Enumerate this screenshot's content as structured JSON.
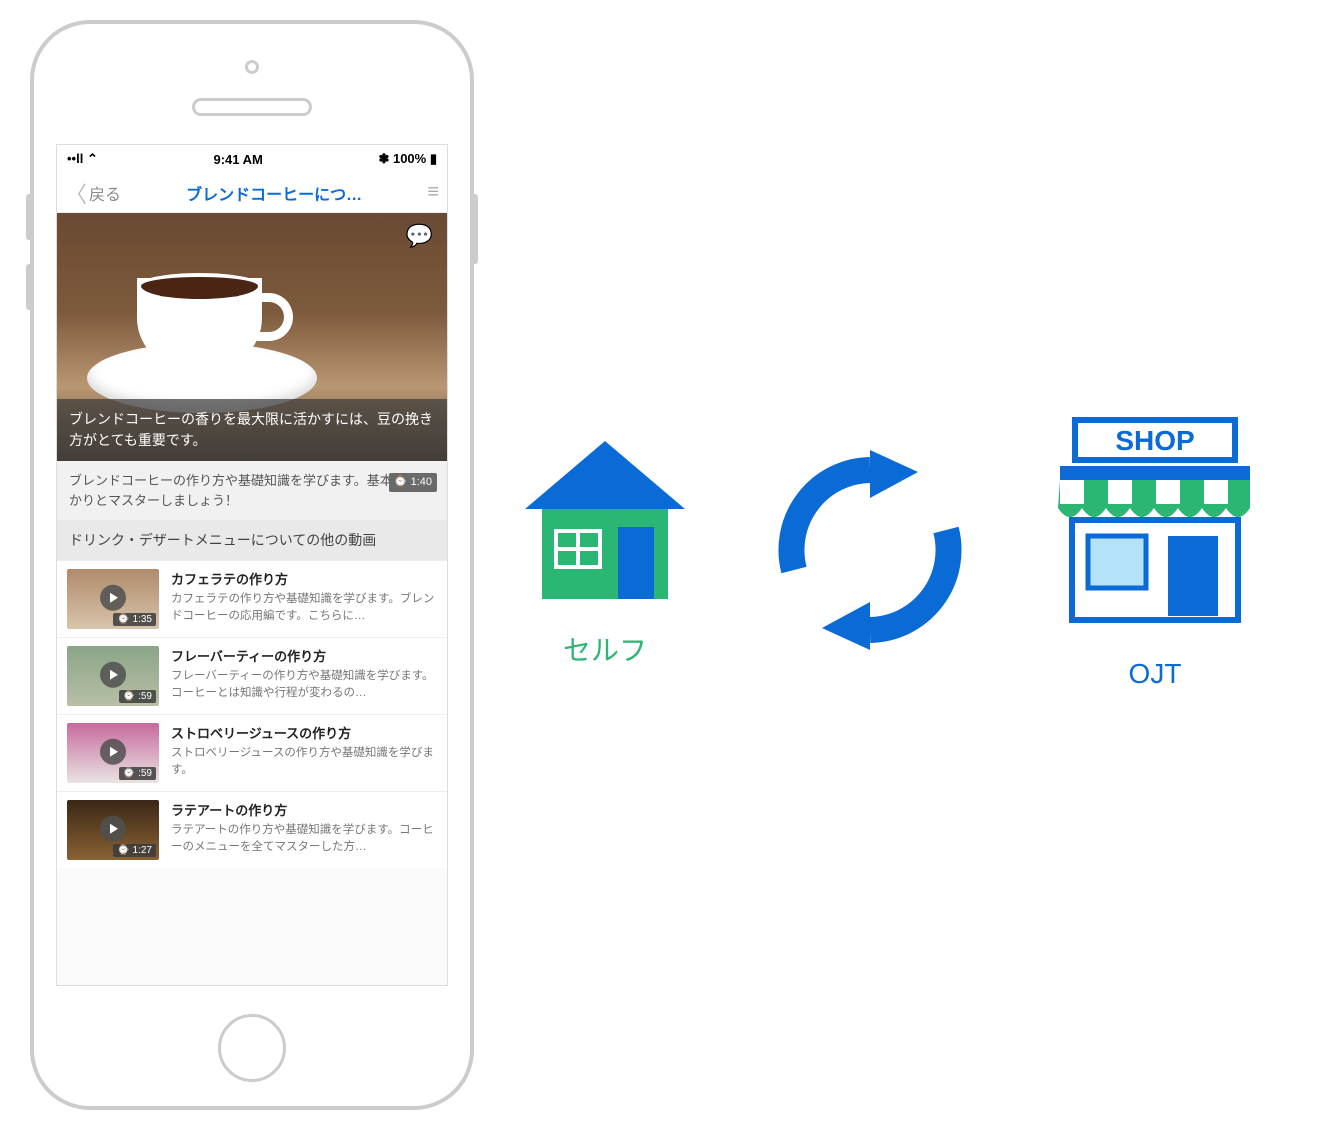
{
  "status": {
    "left": "••ll ⌃",
    "time": "9:41 AM",
    "right": "✽ 100% ▮"
  },
  "nav": {
    "back": "戻る",
    "title": "ブレンドコーヒーにつ…"
  },
  "hero": {
    "caption": "ブレンドコーヒーの香りを最大限に活かすには、豆の挽き方がとても重要です。"
  },
  "desc": {
    "text": "ブレンドコーヒーの作り方や基礎知識を学びます。基本をしっかりとマスターしましょう！",
    "duration": "⌚ 1:40"
  },
  "section_head": "ドリンク・デザートメニューについての他の動画",
  "videos": [
    {
      "title": "カフェラテの作り方",
      "desc": "カフェラテの作り方や基礎知識を学びます。ブレンドコーヒーの応用編です。こちらに…",
      "duration": "⌚ 1:35"
    },
    {
      "title": "フレーバーティーの作り方",
      "desc": "フレーバーティーの作り方や基礎知識を学びます。コーヒーとは知識や行程が変わるの…",
      "duration": "⌚ :59"
    },
    {
      "title": "ストロベリージュースの作り方",
      "desc": "ストロベリージュースの作り方や基礎知識を学びます。",
      "duration": "⌚ :59"
    },
    {
      "title": "ラテアートの作り方",
      "desc": "ラテアートの作り方や基礎知識を学びます。コーヒーのメニューを全てマスターした方…",
      "duration": "⌚ 1:27"
    }
  ],
  "diagram": {
    "self_label": "セルフ",
    "ojt_label": "OJT",
    "shop_sign": "SHOP"
  }
}
